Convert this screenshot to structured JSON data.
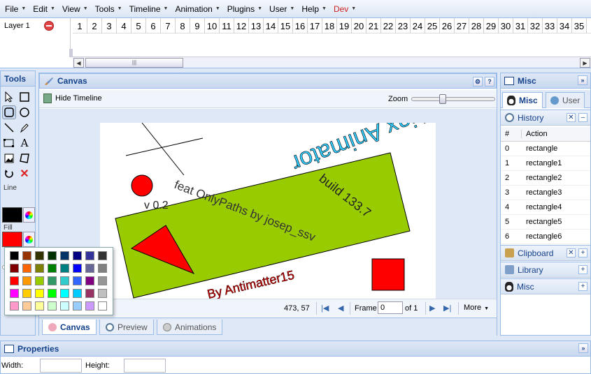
{
  "menubar": {
    "items": [
      "File",
      "Edit",
      "View",
      "Tools",
      "Timeline",
      "Animation",
      "Plugins",
      "User",
      "Help",
      "Dev"
    ]
  },
  "timeline": {
    "layer_name": "Layer 1",
    "frames": [
      "1",
      "2",
      "3",
      "4",
      "5",
      "6",
      "7",
      "8",
      "9",
      "10",
      "11",
      "12",
      "13",
      "14",
      "15",
      "16",
      "17",
      "18",
      "19",
      "20",
      "21",
      "22",
      "23",
      "24",
      "25",
      "26",
      "27",
      "28",
      "29",
      "30",
      "31",
      "32",
      "33",
      "34",
      "35"
    ]
  },
  "tools": {
    "title": "Tools",
    "line_label": "Line",
    "fill_label": "Fill",
    "line_color": "#000000",
    "fill_color": "#ff0000",
    "icons": [
      "arrow-select-icon",
      "select-box-icon",
      "rounded-rect-icon",
      "circle-icon",
      "line-icon",
      "pen-icon",
      "path-icon",
      "text-icon",
      "image-icon",
      "shape-edit-icon",
      "undo-icon",
      "delete-icon"
    ]
  },
  "palette": {
    "colors": [
      "#000000",
      "#993300",
      "#333300",
      "#003300",
      "#003366",
      "#000080",
      "#333399",
      "#333333",
      "#800000",
      "#ff6600",
      "#808000",
      "#008000",
      "#008080",
      "#0000ff",
      "#666699",
      "#808080",
      "#ff0000",
      "#ff9900",
      "#99cc00",
      "#339966",
      "#33cccc",
      "#3366ff",
      "#800080",
      "#969696",
      "#ff00ff",
      "#ffcc00",
      "#ffff00",
      "#00ff00",
      "#00ffff",
      "#00ccff",
      "#993366",
      "#c0c0c0",
      "#ff99cc",
      "#ffcc99",
      "#ffff99",
      "#ccffcc",
      "#ccffff",
      "#99ccff",
      "#cc99ff",
      "#ffffff"
    ]
  },
  "canvas": {
    "title": "Canvas",
    "hide_timeline": "Hide Timeline",
    "zoom_label": "Zoom",
    "zoom_level": 0.35,
    "coords": "473, 57",
    "frame_label": "Frame",
    "frame_value": "0",
    "of_label": "of 1",
    "more_label": "More",
    "tabs": [
      "Canvas",
      "Preview",
      "Animations"
    ],
    "drawing": {
      "texts": {
        "title": "Ajax Animator",
        "version": "v 0.2",
        "feat": "feat OnlyPaths by josep_ssv",
        "build": "build 133.7",
        "author": "By Antimatter15"
      },
      "colors": {
        "green": "#99cc00",
        "red": "#ff0000",
        "title_fill": "#33ccff",
        "author_fill": "#cc0000"
      }
    }
  },
  "misc": {
    "title": "Misc",
    "tabs": [
      "Misc",
      "User"
    ],
    "history": {
      "title": "History",
      "col_num": "#",
      "col_action": "Action",
      "rows": [
        {
          "n": "0",
          "action": "rectangle"
        },
        {
          "n": "1",
          "action": "rectangle1"
        },
        {
          "n": "2",
          "action": "rectangle2"
        },
        {
          "n": "3",
          "action": "rectangle3"
        },
        {
          "n": "4",
          "action": "rectangle4"
        },
        {
          "n": "5",
          "action": "rectangle5"
        },
        {
          "n": "6",
          "action": "rectangle6"
        }
      ]
    },
    "sections": [
      "Clipboard",
      "Library",
      "Misc"
    ]
  },
  "properties": {
    "title": "Properties",
    "width_label": "Width:",
    "height_label": "Height:"
  }
}
